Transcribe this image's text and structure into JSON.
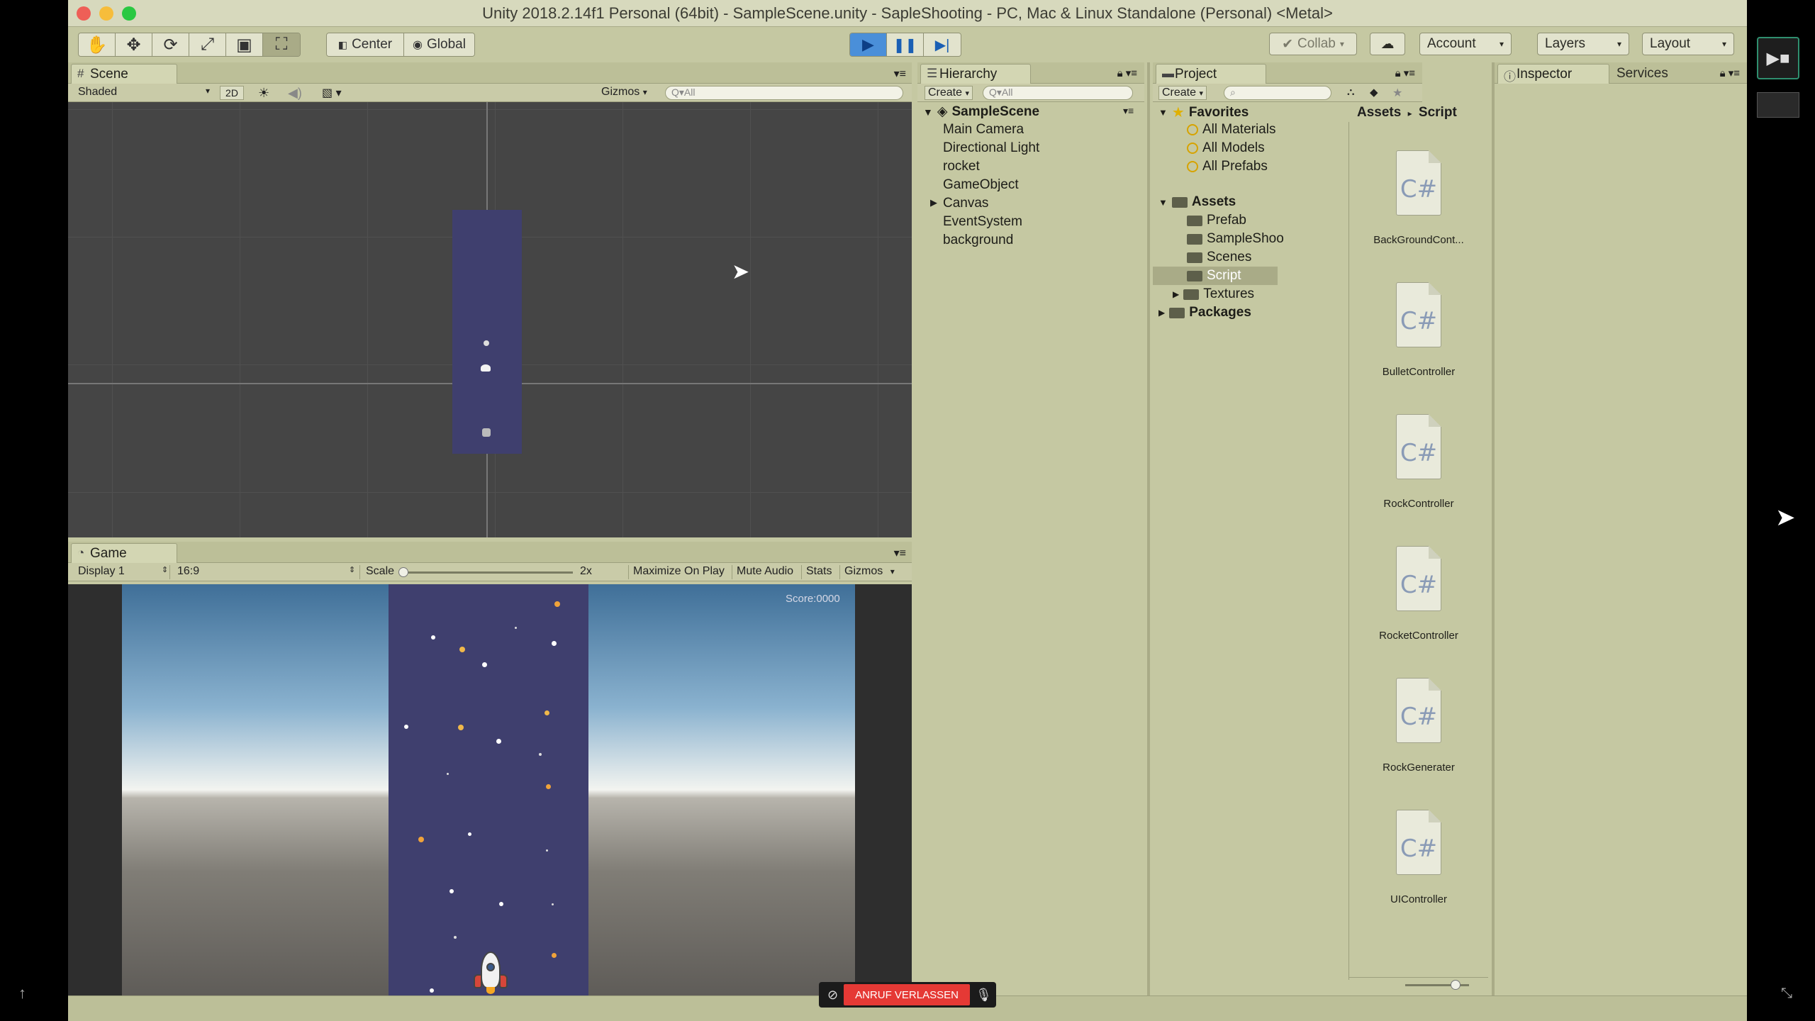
{
  "window": {
    "title": "Unity 2018.2.14f1 Personal (64bit) - SampleScene.unity - SapleShooting - PC, Mac & Linux Standalone (Personal) <Metal>"
  },
  "toolbar": {
    "pivot_center": "Center",
    "pivot_global": "Global",
    "collab": "Collab",
    "account": "Account",
    "layers": "Layers",
    "layout": "Layout"
  },
  "scene": {
    "tab": "Scene",
    "shading": "Shaded",
    "mode_2d": "2D",
    "gizmos": "Gizmos",
    "search_placeholder": "Q▾All"
  },
  "game": {
    "tab": "Game",
    "display": "Display 1",
    "aspect": "16:9",
    "scale_label": "Scale",
    "scale_value": "2x",
    "maximize": "Maximize On Play",
    "mute": "Mute Audio",
    "stats": "Stats",
    "gizmos": "Gizmos",
    "score": "Score:0000"
  },
  "hierarchy": {
    "tab": "Hierarchy",
    "create": "Create",
    "search_placeholder": "Q▾All",
    "scene_name": "SampleScene",
    "items": [
      "Main Camera",
      "Directional Light",
      "rocket",
      "GameObject",
      "Canvas",
      "EventSystem",
      "background"
    ]
  },
  "project": {
    "tab": "Project",
    "create": "Create",
    "favorites": "Favorites",
    "favorite_items": [
      "All Materials",
      "All Models",
      "All Prefabs"
    ],
    "assets": "Assets",
    "asset_folders": [
      "Prefab",
      "SampleShoo",
      "Scenes",
      "Script",
      "Textures"
    ],
    "packages": "Packages",
    "breadcrumb_root": "Assets",
    "breadcrumb_sep": "▸",
    "breadcrumb_current": "Script",
    "files": [
      "BackGroundCont...",
      "BulletController",
      "RockController",
      "RocketController",
      "RockGenerater",
      "UIController"
    ],
    "file_glyph": "C#"
  },
  "inspector": {
    "tab": "Inspector",
    "services": "Services"
  },
  "call": {
    "leave": "ANRUF VERLASSEN"
  },
  "colors": {
    "editor_bg": "#c5c8a2",
    "scene_bg": "#454545",
    "space": "#3f3f6e",
    "play_active": "#4a8fd9",
    "leave_red": "#e53935"
  }
}
